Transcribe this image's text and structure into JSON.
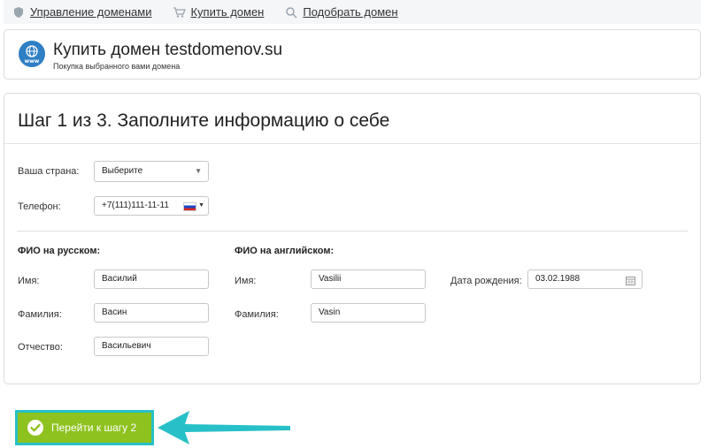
{
  "nav": {
    "items": [
      {
        "label": "Управление доменами",
        "icon": "shield-icon"
      },
      {
        "label": "Купить домен",
        "icon": "cart-icon"
      },
      {
        "label": "Подобрать домен",
        "icon": "search-icon"
      }
    ]
  },
  "header": {
    "title": "Купить домен testdomenov.su",
    "subtitle": "Покупка выбранного вами домена",
    "icon": "globe-www-icon"
  },
  "form": {
    "step_title": "Шаг 1 из 3. Заполните информацию о себе",
    "country": {
      "label": "Ваша страна:",
      "value": "Выберите"
    },
    "phone": {
      "label": "Телефон:",
      "value": "+7(111)111-11-11",
      "flag": "ru-flag-icon"
    },
    "ru_section": "ФИО на русском:",
    "en_section": "ФИО на английском:",
    "ru": {
      "first_name": {
        "label": "Имя:",
        "value": "Василий"
      },
      "last_name": {
        "label": "Фамилия:",
        "value": "Васин"
      },
      "patronymic": {
        "label": "Отчество:",
        "value": "Васильевич"
      }
    },
    "en": {
      "first_name": {
        "label": "Имя:",
        "value": "Vasilii"
      },
      "last_name": {
        "label": "Фамилия:",
        "value": "Vasin"
      }
    },
    "birthdate": {
      "label": "Дата рождения:",
      "value": "03.02.1988"
    }
  },
  "actions": {
    "next_label": "Перейти к шагу 2"
  },
  "colors": {
    "button": "#8ec21f",
    "highlight": "#27c0c8",
    "globe": "#2e7fc4"
  }
}
